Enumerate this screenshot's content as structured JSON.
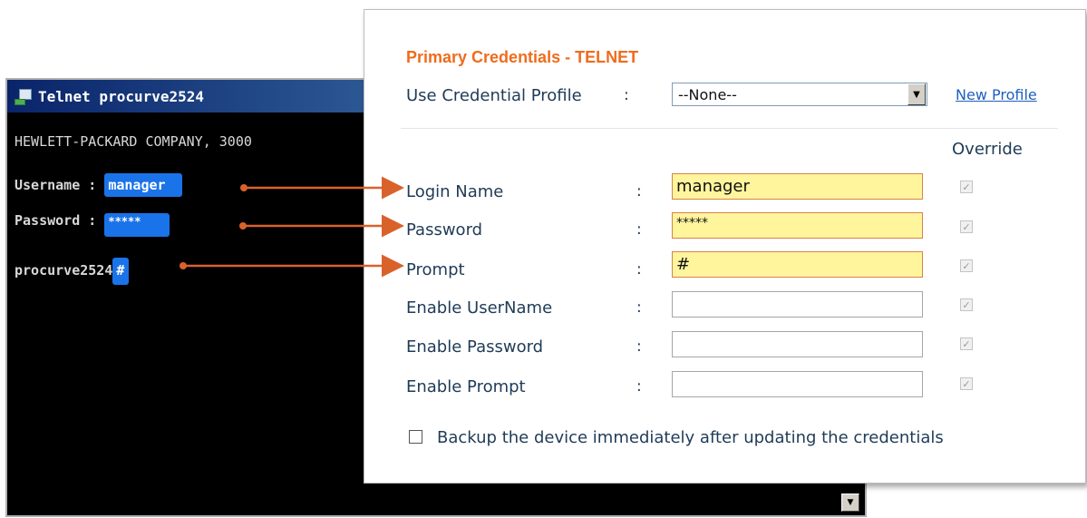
{
  "telnet": {
    "title": "Telnet procurve2524",
    "banner": "HEWLETT-PACKARD COMPANY, 3000",
    "username_label": "Username :",
    "username_value": "manager",
    "password_label": "Password :",
    "password_value": "*****",
    "prompt_host": "procurve2524",
    "prompt_value": "#",
    "icon": "telnet-app-icon"
  },
  "credentials": {
    "title": "Primary Credentials - TELNET",
    "profile_label": "Use Credential Profile",
    "colon": ":",
    "profile_value": "--None--",
    "new_profile_link": "New Profile",
    "override_header": "Override",
    "fields": [
      {
        "label": "Login Name",
        "value": "manager",
        "override": true
      },
      {
        "label": "Password",
        "value": "*****",
        "override": true
      },
      {
        "label": "Prompt",
        "value": "#",
        "override": true
      },
      {
        "label": "Enable UserName",
        "value": "",
        "override": true
      },
      {
        "label": "Enable Password",
        "value": "",
        "override": true
      },
      {
        "label": "Enable Prompt",
        "value": "",
        "override": true
      }
    ],
    "backup_label": "Backup the device immediately after updating the credentials",
    "backup_checked": false
  },
  "colors": {
    "accent_orange": "#ef6c1d",
    "highlight_blue": "#1a73e8",
    "field_highlight": "#fff59d",
    "arrow": "#d9622b"
  }
}
